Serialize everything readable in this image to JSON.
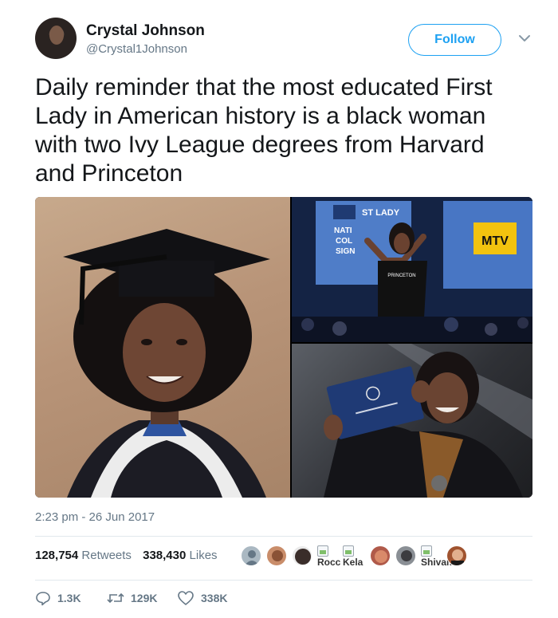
{
  "author": {
    "name": "Crystal Johnson",
    "handle": "@Crystal1Johnson",
    "avatar_icon": "profile-photo"
  },
  "header": {
    "follow_label": "Follow",
    "menu_icon": "chevron-down-icon"
  },
  "tweet": {
    "text": "Daily reminder that the most educated First Lady in American history is a black woman with two Ivy League degrees from Harvard and Princeton",
    "timestamp": "2:23 pm - 26 Jun 2017"
  },
  "media": {
    "images": [
      {
        "name": "graduation-portrait-photo"
      },
      {
        "name": "stage-event-photo",
        "sign_text": "ST LADY",
        "sign_lines": [
          "NATI",
          "COL",
          "SIGN"
        ],
        "logo_text": "MTV",
        "shirt_text": "PRINCETON"
      },
      {
        "name": "diploma-holding-photo"
      }
    ]
  },
  "stats": {
    "retweets_count": "128,754",
    "retweets_label": "Retweets",
    "likes_count": "338,430",
    "likes_label": "Likes"
  },
  "likers": [
    {
      "type": "default-avatar"
    },
    {
      "type": "photo",
      "color": "#c98d6a"
    },
    {
      "type": "photo",
      "color": "#3a2d2a"
    },
    {
      "type": "broken",
      "caption": "Rocc"
    },
    {
      "type": "broken",
      "caption": "Kela"
    },
    {
      "type": "photo",
      "color": "#b05a4a"
    },
    {
      "type": "photo",
      "color": "#8a8f95"
    },
    {
      "type": "broken",
      "caption": "Shivam"
    },
    {
      "type": "photo",
      "color": "#a0532f"
    }
  ],
  "actions": {
    "reply_count": "1.3K",
    "retweet_count": "129K",
    "like_count": "338K"
  },
  "colors": {
    "brand_blue": "#1da1f2",
    "secondary_text": "#657786",
    "divider": "#e1e8ed"
  }
}
